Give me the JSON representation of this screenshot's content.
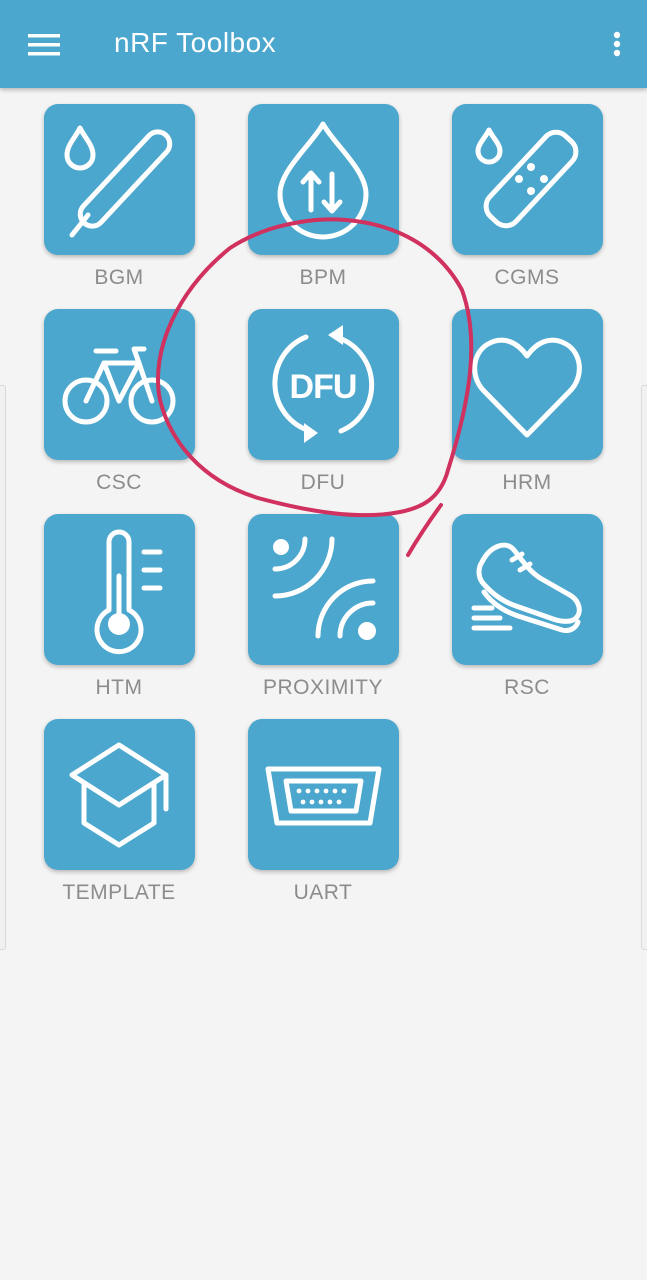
{
  "appbar": {
    "title": "nRF Toolbox",
    "menu_icon": "hamburger-menu-icon",
    "more_icon": "more-vert-icon"
  },
  "apps": [
    {
      "label": "BGM",
      "icon": "glucose-meter-icon"
    },
    {
      "label": "BPM",
      "icon": "blood-pressure-drop-icon"
    },
    {
      "label": "CGMS",
      "icon": "glucose-patch-icon"
    },
    {
      "label": "CSC",
      "icon": "bicycle-icon"
    },
    {
      "label": "DFU",
      "icon": "dfu-icon",
      "icon_text": "DFU"
    },
    {
      "label": "HRM",
      "icon": "heart-icon"
    },
    {
      "label": "HTM",
      "icon": "thermometer-icon"
    },
    {
      "label": "PROXIMITY",
      "icon": "proximity-signal-icon"
    },
    {
      "label": "RSC",
      "icon": "running-shoe-icon"
    },
    {
      "label": "TEMPLATE",
      "icon": "graduation-cap-icon"
    },
    {
      "label": "UART",
      "icon": "serial-port-icon"
    }
  ],
  "colors": {
    "primary": "#4ba7cd",
    "background": "#f4f4f4",
    "label": "#8c8c8c",
    "annotation": "#d0315e"
  }
}
